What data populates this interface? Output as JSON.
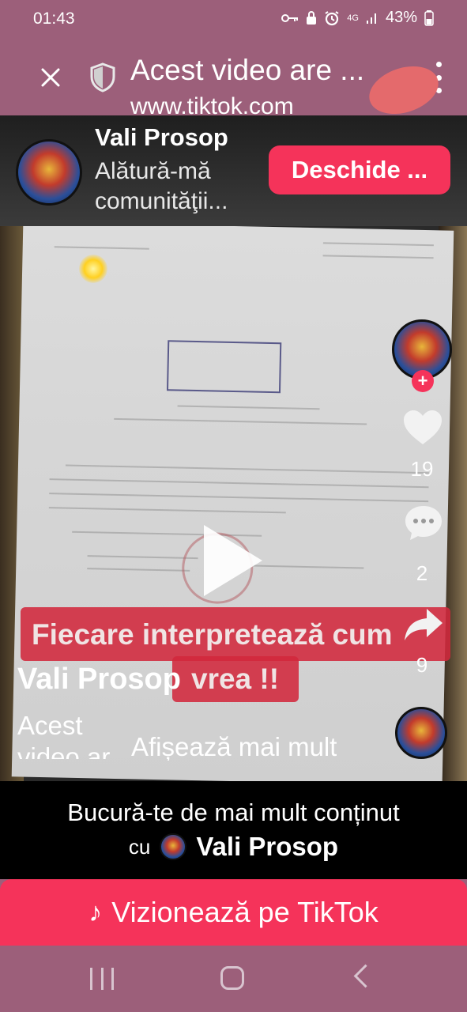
{
  "status_bar": {
    "time": "01:43",
    "network": "4G",
    "battery": "43%"
  },
  "browser": {
    "title": "Acest video are ...",
    "url": "www.tiktok.com"
  },
  "banner": {
    "name": "Vali Prosop",
    "subtitle": "Alătură-mă comunităţii...",
    "open_button": "Deschide ..."
  },
  "actions": {
    "follow": "+",
    "likes": "19",
    "comments": "2",
    "shares": "9"
  },
  "caption": {
    "line1": "Fiecare interpretează cum",
    "line2": "vrea !!"
  },
  "post": {
    "author": "Vali Prosop",
    "description": "Acest video ar",
    "show_more": "Afișează mai mult"
  },
  "promo": {
    "line1": "Bucură-te de mai mult conținut",
    "cu": "cu",
    "name": "Vali Prosop"
  },
  "watch_button": {
    "icon": "♪",
    "label": "Vizionează pe TikTok"
  },
  "colors": {
    "accent": "#f5335a",
    "chrome": "#9c5f7a"
  }
}
